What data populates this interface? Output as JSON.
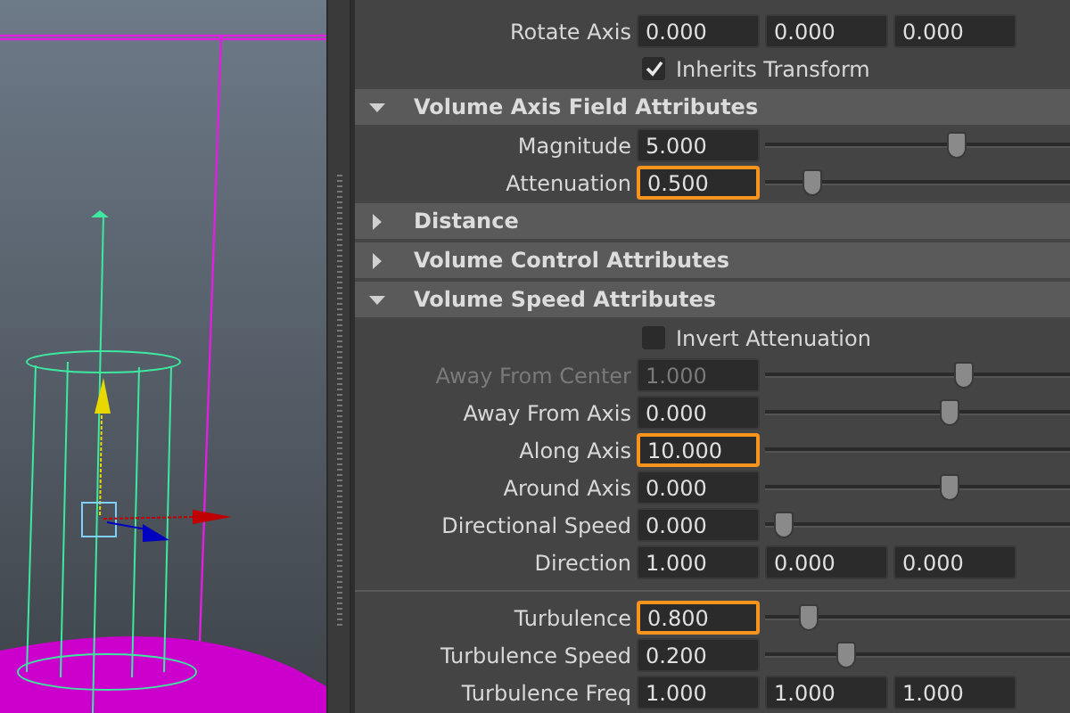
{
  "rows": [
    {
      "kind": "vector",
      "label": "Rotate Axis",
      "values": [
        "0.000",
        "0.000",
        "0.000"
      ]
    },
    {
      "kind": "checkbox",
      "label": "Inherits Transform",
      "checked": true
    },
    {
      "kind": "header",
      "label": "Volume Axis Field Attributes",
      "expanded": true
    },
    {
      "kind": "slider",
      "label": "Magnitude",
      "value": "5.000",
      "level": 0.64,
      "highlighted": false,
      "disabled": false
    },
    {
      "kind": "slider",
      "label": "Attenuation",
      "value": "0.500",
      "level": 0.13,
      "highlighted": true,
      "disabled": false
    },
    {
      "kind": "header",
      "label": "Distance",
      "expanded": false
    },
    {
      "kind": "header",
      "label": "Volume Control Attributes",
      "expanded": false
    },
    {
      "kind": "header",
      "label": "Volume Speed Attributes",
      "expanded": true
    },
    {
      "kind": "checkbox",
      "label": "Invert Attenuation",
      "checked": false
    },
    {
      "kind": "slider",
      "label": "Away From Center",
      "value": "1.000",
      "level": 0.66,
      "highlighted": false,
      "disabled": true
    },
    {
      "kind": "slider",
      "label": "Away From Axis",
      "value": "0.000",
      "level": 0.61,
      "highlighted": false,
      "disabled": false
    },
    {
      "kind": "slider",
      "label": "Along Axis",
      "value": "10.000",
      "highlighted": true,
      "disabled": false
    },
    {
      "kind": "slider",
      "label": "Around Axis",
      "value": "0.000",
      "level": 0.61,
      "highlighted": false,
      "disabled": false
    },
    {
      "kind": "slider",
      "label": "Directional Speed",
      "value": "0.000",
      "level": 0.03,
      "highlighted": false,
      "disabled": false
    },
    {
      "kind": "vector",
      "label": "Direction",
      "values": [
        "1.000",
        "0.000",
        "0.000"
      ]
    },
    {
      "kind": "divider"
    },
    {
      "kind": "slider",
      "label": "Turbulence",
      "value": "0.800",
      "level": 0.12,
      "highlighted": true,
      "disabled": false
    },
    {
      "kind": "slider",
      "label": "Turbulence Speed",
      "value": "0.200",
      "level": 0.25,
      "highlighted": false,
      "disabled": false
    },
    {
      "kind": "vector",
      "label": "Turbulence Freq",
      "values": [
        "1.000",
        "1.000",
        "1.000"
      ]
    }
  ]
}
